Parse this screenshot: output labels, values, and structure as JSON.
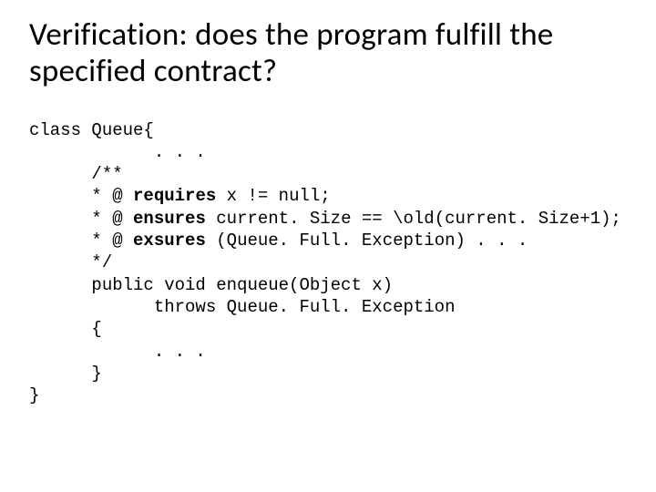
{
  "title": "Verification: does the program fulfill the specified contract?",
  "code": {
    "line1": "class Queue{",
    "line2": "            . . .",
    "line3": "      /**",
    "line4a": "      * @ ",
    "line4b": "requires",
    "line4c": " x != null;",
    "line5a": "      * @ ",
    "line5b": "ensures",
    "line5c": " current. Size == \\old(current. Size+1);",
    "line6a": "      * @ ",
    "line6b": "exsures",
    "line6c": " (Queue. Full. Exception) . . .",
    "line7": "      */",
    "line8": "      public void enqueue(Object x)",
    "line9": "            throws Queue. Full. Exception",
    "line10": "      {",
    "line11": "            . . .",
    "line12": "      }",
    "line13": "}"
  }
}
